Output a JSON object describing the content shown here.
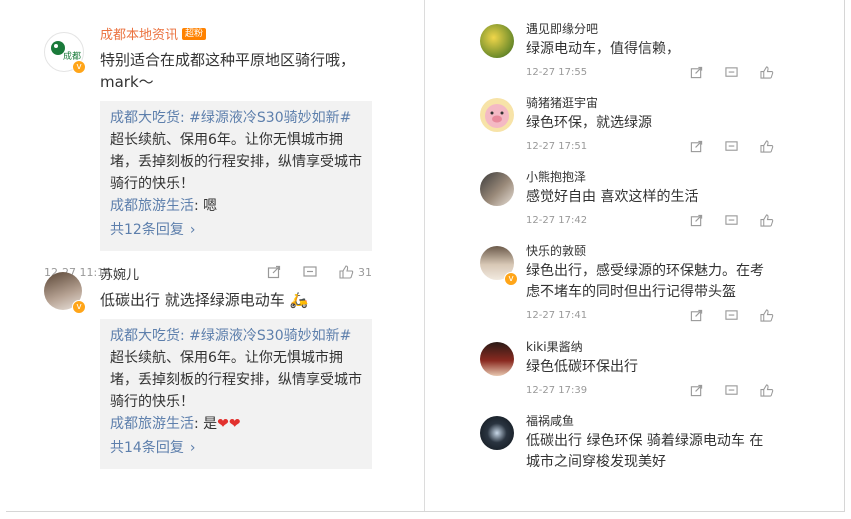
{
  "left": {
    "posts": [
      {
        "name": "成都本地资讯",
        "tag": "超粉",
        "text": "特别适合在成都这种平原地区骑行哦，mark～",
        "quote": {
          "author": "成都大吃货",
          "hashtag": "#绿源液冷S30骑妙如新#",
          "body": "超长续航、保用6年。让你无惧城市拥堵，丢掉刻板的行程安排，纵情享受城市骑行的快乐！",
          "reply_author": "成都旅游生活",
          "reply_text": ": 嗯",
          "reply_count": "共12条回复"
        },
        "time": "12-27 11:15",
        "likes": "31"
      },
      {
        "name": "苏婉儿",
        "text": "低碳出行 就选择绿源电动车",
        "quote": {
          "author": "成都大吃货",
          "hashtag": "#绿源液冷S30骑妙如新#",
          "body": "超长续航、保用6年。让你无惧城市拥堵，丢掉刻板的行程安排，纵情享受城市骑行的快乐！",
          "reply_author": "成都旅游生活",
          "reply_text": ": 是",
          "reply_count": "共14条回复"
        }
      }
    ]
  },
  "right": {
    "comments": [
      {
        "name": "遇见即缘分吧",
        "text": "绿源电动车，值得信赖，",
        "time": "12-27 17:55"
      },
      {
        "name": "骑猪猪逛宇宙",
        "text": "绿色环保，就选绿源",
        "time": "12-27 17:51"
      },
      {
        "name": "小熊抱抱泽",
        "text": "感觉好自由 喜欢这样的生活",
        "time": "12-27 17:42"
      },
      {
        "name": "快乐的敦颐",
        "text": "绿色出行，感受绿源的环保魅力。在考虑不堵车的同时但出行记得带头盔",
        "time": "12-27 17:41"
      },
      {
        "name": "kiki果酱纳",
        "text": "绿色低碳环保出行",
        "time": "12-27 17:39"
      },
      {
        "name": "福祸咸鱼",
        "text": "低碳出行 绿色环保 骑着绿源电动车 在城市之间穿梭发现美好",
        "time": ""
      }
    ]
  },
  "colors": {
    "accent": "#eb7340",
    "link": "#5d7fac",
    "quote_bg": "#f2f2f2",
    "meta": "#999999"
  }
}
